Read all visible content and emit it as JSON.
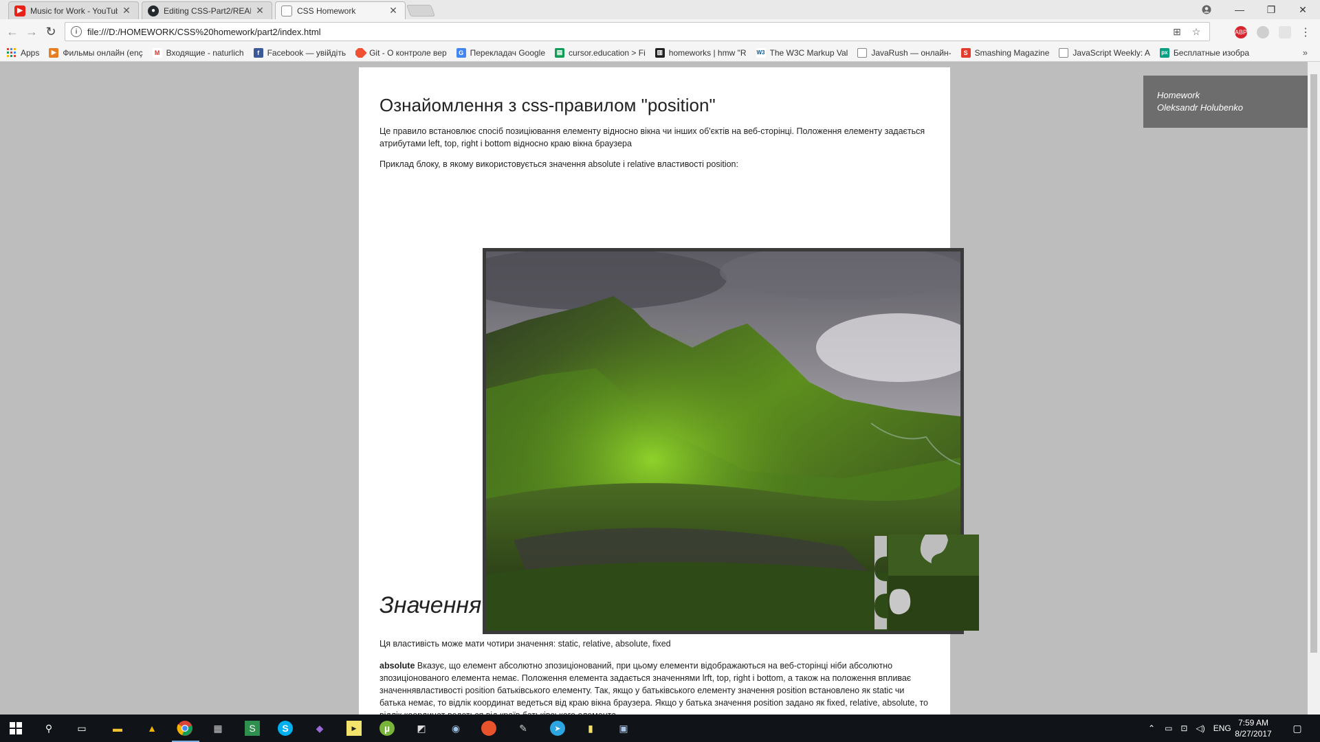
{
  "browser": {
    "tabs": [
      {
        "title": "Music for Work - YouTub",
        "icon": "youtube-icon",
        "color": "#e62117"
      },
      {
        "title": "Editing CSS-Part2/READI",
        "icon": "github-icon",
        "color": "#24292e"
      },
      {
        "title": "CSS Homework",
        "icon": "document-icon",
        "color": "#888888",
        "active": true
      }
    ],
    "url": "file:///D:/HOMEWORK/CSS%20homework/part2/index.html",
    "bookmarks": [
      {
        "label": "Apps",
        "icon": "apps-grid-icon",
        "color": "#4285f4"
      },
      {
        "label": "Фильмы онлайн (enç",
        "icon": "film-icon",
        "color": "#e67e22"
      },
      {
        "label": "Входящие - naturlich",
        "icon": "gmail-icon",
        "color": "#d93025"
      },
      {
        "label": "Facebook — увійдіть",
        "icon": "facebook-icon",
        "color": "#3b5998"
      },
      {
        "label": "Git - О контроле вер",
        "icon": "git-icon",
        "color": "#f05133"
      },
      {
        "label": "Перекладач Google",
        "icon": "translate-icon",
        "color": "#4285f4"
      },
      {
        "label": "cursor.education > Fi",
        "icon": "sheet-icon",
        "color": "#0f9d58"
      },
      {
        "label": "homeworks | hmw \"R",
        "icon": "trello-icon",
        "color": "#222222"
      },
      {
        "label": "The W3C Markup Val",
        "icon": "w3c-icon",
        "color": "#005a9c"
      },
      {
        "label": "JavaRush — онлайн-",
        "icon": "page-icon",
        "color": "#777777"
      },
      {
        "label": "Smashing Magazine",
        "icon": "smashing-icon",
        "color": "#e53b2c"
      },
      {
        "label": "JavaScript Weekly: A",
        "icon": "page-icon",
        "color": "#777777"
      },
      {
        "label": "Бесплатные изобра",
        "icon": "pexels-icon",
        "color": "#05a081"
      }
    ],
    "bookmarks_more": "»"
  },
  "page": {
    "heading": "Ознайомлення з css-правилом \"position\"",
    "intro": "Це правило встановлює спосіб позиціювання елементу відносно вікна чи інших об'єктів на веб-сторінці. Положення елементу задається атрибутами left, top, right і bottom відносно краю вікна браузера",
    "example_text": "Приклад блоку, в якому використовується значення absolute і relative властивості position:",
    "section_heading": "Значення",
    "values_text": "Ця властивість може мати чотири значення: static, relative, absolute, fixed",
    "absolute_term": "absolute",
    "absolute_text": " Вказує, що елемент абсолютно зпозиціонований, при цьому елементи відображаються на веб-сторінці ніби абсолютно зпозиціонованого елемента немає. Положення елемента задається значеннями lrft, top, right і bottom, а також на положення впливає значеннявластивості position батьківського елементу. Так, якщо у батьківського елементу значення position встановлено як static чи батька немає, то відлік координат ведеться від краю вікна браузера. Якщо у батька значення position задано як fixed, relative, absolute, то відлік координат ведеться від країв батьківського елемента."
  },
  "sidebox": {
    "line1": "Homework",
    "line2": "Oleksandr Holubenko"
  },
  "taskbar": {
    "lang": "ENG",
    "time": "7:59 AM",
    "date": "8/27/2017"
  }
}
